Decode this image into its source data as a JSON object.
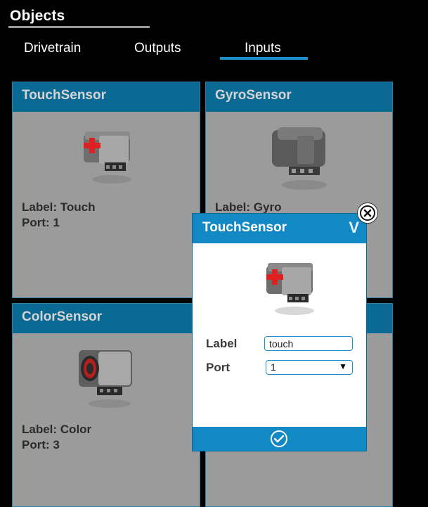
{
  "header": {
    "title": "Objects"
  },
  "tabs": [
    {
      "label": "Drivetrain",
      "active": false
    },
    {
      "label": "Outputs",
      "active": false
    },
    {
      "label": "Inputs",
      "active": true
    }
  ],
  "cards": [
    {
      "title": "TouchSensor",
      "label_line": "Label: Touch",
      "port_line": "Port: 1",
      "icon": "touch-sensor-icon"
    },
    {
      "title": "GyroSensor",
      "label_line": "Label: Gyro",
      "icon": "gyro-sensor-icon"
    },
    {
      "title": "ColorSensor",
      "label_line": "Label: Color",
      "port_line": "Port: 3",
      "icon": "color-sensor-icon"
    }
  ],
  "dialog": {
    "title": "TouchSensor",
    "header_glyph": "V",
    "label_caption": "Label",
    "label_value": "touch",
    "port_caption": "Port",
    "port_value": "1",
    "confirm_icon": "check-circle-icon",
    "close_icon": "close-circle-icon"
  },
  "colors": {
    "card_header": "#0a6a93",
    "dialog_header": "#1288c4",
    "tab_underline": "#1d8fc9",
    "card_body": "#9b9b9b"
  }
}
